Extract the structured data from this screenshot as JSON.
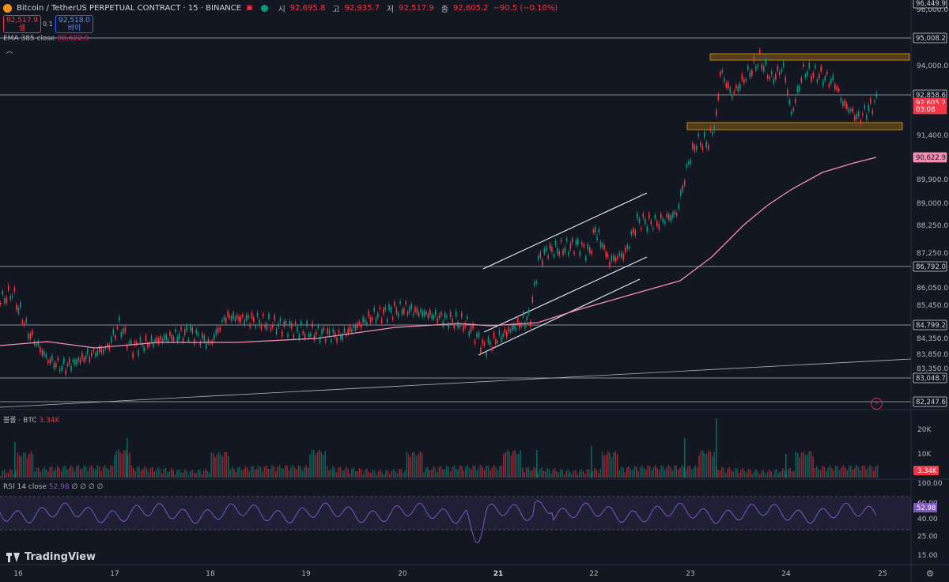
{
  "header": {
    "title": "Bitcoin / TetherUS PERPETUAL CONTRACT · 15 · BINANCE",
    "open_label": "시",
    "open": "92,695.8",
    "high_label": "고",
    "high": "92,935.7",
    "low_label": "저",
    "low": "92,517.9",
    "close_label": "종",
    "close": "92,605.2",
    "change": "−90.5 (−0.10%)"
  },
  "quote": {
    "sell_price": "92,517.9",
    "sell_label": "셀",
    "spread": "0.1",
    "buy_price": "92,518.0",
    "buy_label": "바이"
  },
  "indicators": {
    "ema_label": "EMA 385 close",
    "ema_value": "90,622.9",
    "volume_label": "볼륨 · BTC",
    "volume_value": "3.34K",
    "rsi_label": "RSI 14 close",
    "rsi_value": "52.98",
    "rsi_extra": "∅ ∅ ∅ ∅"
  },
  "price_axis": {
    "ticks": [
      "96,000.0",
      "94,000.0",
      "91,400.0",
      "89,900.0",
      "89,000.0",
      "88,250.0",
      "87,250.0",
      "86,050.0",
      "85,450.0",
      "84,350.0",
      "83,850.0",
      "83,350.0"
    ],
    "labels": [
      {
        "text": "96,449.9",
        "kind": "level"
      },
      {
        "text": "95,008.2",
        "kind": "level"
      },
      {
        "text": "92,858.6",
        "kind": "level"
      },
      {
        "text": "92,605.2",
        "kind": "current"
      },
      {
        "text": "03:08",
        "kind": "timer"
      },
      {
        "text": "90,622.9",
        "kind": "ema"
      },
      {
        "text": "86,792.0",
        "kind": "level"
      },
      {
        "text": "84,799.2",
        "kind": "level"
      },
      {
        "text": "83,048.7",
        "kind": "level"
      },
      {
        "text": "82,247.6",
        "kind": "level"
      }
    ]
  },
  "volume_axis": {
    "ticks": [
      "20K",
      "10K"
    ],
    "current": "3.34K"
  },
  "rsi_axis": {
    "ticks": [
      "100.00",
      "60.00",
      "40.00",
      "25.00",
      "15.00"
    ],
    "current": "52.98"
  },
  "time_axis": {
    "ticks": [
      "16",
      "17",
      "18",
      "19",
      "20",
      "21",
      "22",
      "23",
      "24",
      "25"
    ]
  },
  "brand": {
    "name": "TradingView"
  },
  "colors": {
    "background": "#131722",
    "up": "#089981",
    "down": "#f23645",
    "ema": "#f48fb1",
    "rsi": "#7e57c2",
    "zone": "#c8860d"
  },
  "icons": {
    "settings": "gear-icon",
    "alert": "lightning-icon",
    "collapse": "chevron-up-icon"
  }
}
